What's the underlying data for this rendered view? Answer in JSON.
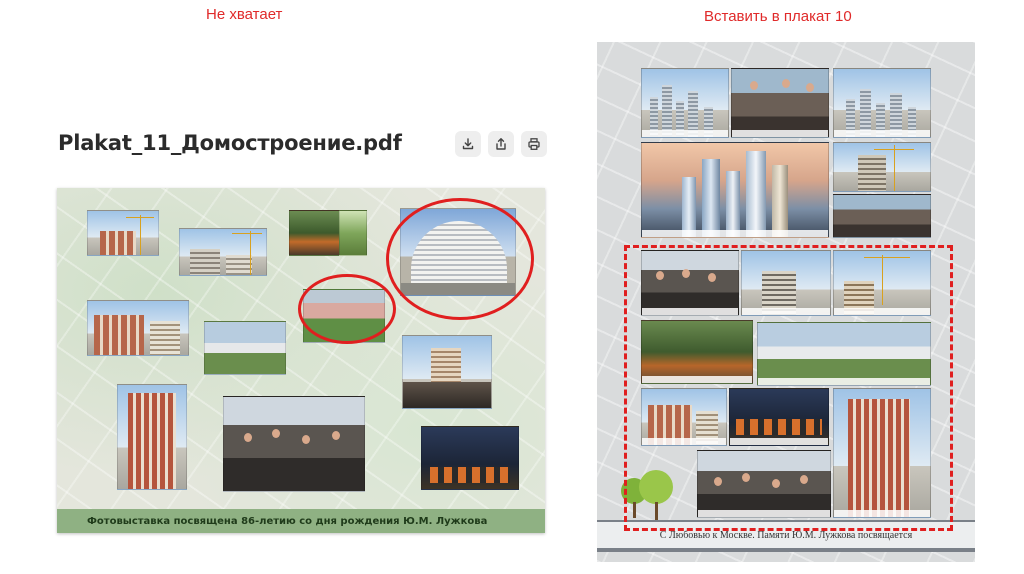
{
  "captions": {
    "left": "Не хватает",
    "right": "Вставить в плакат 10"
  },
  "document": {
    "title": "Plakat_11_Домостроение.pdf",
    "actions": [
      {
        "name": "download-button",
        "icon": "download-icon"
      },
      {
        "name": "share-button",
        "icon": "share-icon"
      },
      {
        "name": "print-button",
        "icon": "print-icon"
      }
    ]
  },
  "poster_left": {
    "footer": "Фотовыставка посвящена 86-летию со дня рождения Ю.М. Лужкова"
  },
  "poster_right": {
    "footer": "С Любовью к Москве. Памяти Ю.М. Лужкова посвящается"
  },
  "colors": {
    "annotation_red": "#e01f1f",
    "left_footer_green": "#8fb183",
    "title_text": "#2b2b2b"
  }
}
